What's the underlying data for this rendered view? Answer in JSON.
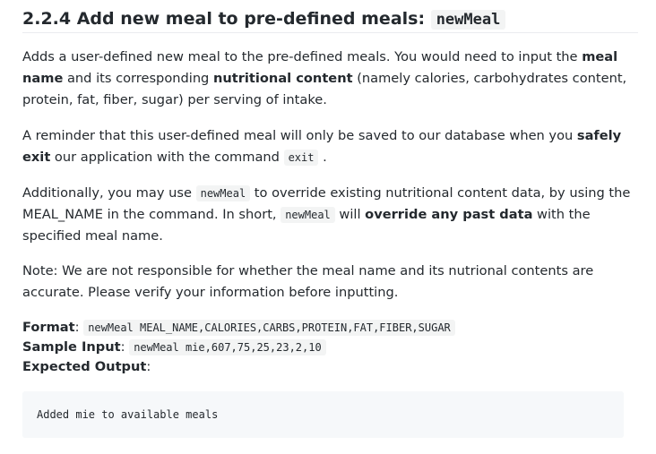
{
  "heading": {
    "number": "2.2.4 Add new meal to pre-defined meals:",
    "code": "newMeal"
  },
  "p1": {
    "t1": "Adds a user-defined new meal to the pre-defined meals. You would need to input the ",
    "b1": "meal name",
    "t2": " and its corresponding ",
    "b2": "nutritional content",
    "t3": " (namely calories, carbohydrates content, protein, fat, fiber, sugar) per serving of intake."
  },
  "p2": {
    "t1": "A reminder that this user-defined meal will only be saved to our database when you ",
    "b1": "safely exit",
    "t2": " our application with the command ",
    "code": "exit",
    "t3": " ."
  },
  "p3": {
    "t1": "Additionally, you may use ",
    "code1": "newMeal",
    "t2": " to override existing nutritional content data, by using the MEAL_NAME in the command. In short, ",
    "code2": "newMeal",
    "t3": " will ",
    "b1": "override any past data",
    "t4": " with the specified meal name."
  },
  "p4": "Note: We are not responsible for whether the meal name and its nutrional contents are accurate. Please verify your information before inputting.",
  "format": {
    "format_label": "Format",
    "format_sep": ": ",
    "format_code": "newMeal MEAL_NAME,CALORIES,CARBS,PROTEIN,FAT,FIBER,SUGAR",
    "sample_label": "Sample Input",
    "sample_sep": ": ",
    "sample_code": "newMeal mie,607,75,25,23,2,10",
    "expected_label": "Expected Output",
    "expected_sep": ":"
  },
  "output": "Added mie to available meals"
}
